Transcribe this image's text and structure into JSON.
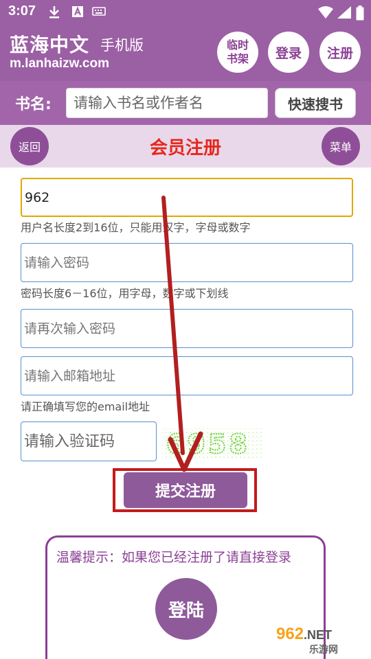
{
  "status_bar": {
    "time": "3:07"
  },
  "header": {
    "site_title": "蓝海中文",
    "site_subtitle": "手机版",
    "site_url": "m.lanhaizw.com",
    "shelf_label_line1": "临时",
    "shelf_label_line2": "书架",
    "login_label": "登录",
    "register_label": "注册"
  },
  "search": {
    "label": "书名:",
    "placeholder": "请输入书名或作者名",
    "button_label": "快速搜书"
  },
  "titlebar": {
    "back_label": "返回",
    "title": "会员注册",
    "menu_label": "菜单"
  },
  "form": {
    "username_value": "962",
    "username_hint": "用户名长度2到16位，只能用汉字，字母或数字",
    "password_placeholder": "请输入密码",
    "password_hint": "密码长度6－16位，用字母，数字或下划线",
    "confirm_placeholder": "请再次输入密码",
    "email_placeholder": "请输入邮箱地址",
    "email_hint": "请正确填写您的email地址",
    "captcha_placeholder": "请输入验证码",
    "captcha_text": "6958",
    "submit_label": "提交注册"
  },
  "tip": {
    "text": "温馨提示：如果您已经注册了请直接登录",
    "login_label": "登陆"
  },
  "watermark": {
    "top_num": "962",
    "top_net": ".NET",
    "bottom": "乐游网"
  },
  "colors": {
    "brand_purple": "#9b5fa4",
    "title_red": "#e5281c",
    "highlight_red": "#c41a1a",
    "focus_border": "#e0a800",
    "input_border": "#5a8fcf"
  }
}
